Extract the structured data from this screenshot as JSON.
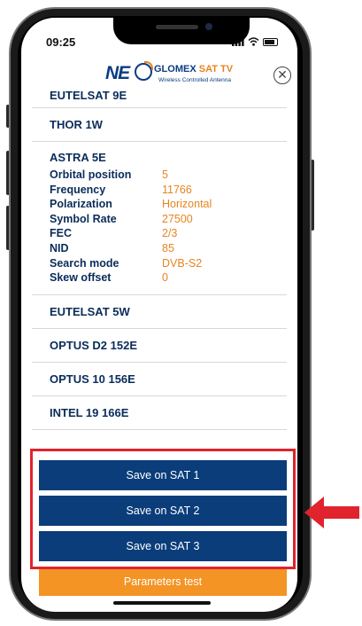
{
  "status_bar": {
    "time": "09:25"
  },
  "header": {
    "logo_mark": "NE",
    "brand_prefix": "GLOMEX ",
    "brand_highlight": "SAT TV",
    "brand_tagline": "Wireless Controlled Antenna",
    "close_symbol": "✕"
  },
  "satellites": {
    "partial": "EUTELSAT 9E",
    "before": [
      "THOR 1W"
    ],
    "expanded": {
      "name": "ASTRA 5E",
      "params": [
        {
          "label": "Orbital position",
          "value": "5"
        },
        {
          "label": "Frequency",
          "value": "11766"
        },
        {
          "label": "Polarization",
          "value": "Horizontal"
        },
        {
          "label": "Symbol Rate",
          "value": "27500"
        },
        {
          "label": "FEC",
          "value": "2/3"
        },
        {
          "label": "NID",
          "value": "85"
        },
        {
          "label": "Search mode",
          "value": "DVB-S2"
        },
        {
          "label": "Skew offset",
          "value": "0"
        }
      ]
    },
    "after": [
      "EUTELSAT 5W",
      "OPTUS D2 152E",
      "OPTUS 10 156E",
      "INTEL 19 166E"
    ]
  },
  "actions": {
    "save_sat1": "Save on SAT 1",
    "save_sat2": "Save on SAT 2",
    "save_sat3": "Save on SAT 3",
    "parameters_test": "Parameters test"
  },
  "colors": {
    "navy": "#0a3d7a",
    "orange": "#f39425",
    "highlight_red": "#e0232c"
  }
}
